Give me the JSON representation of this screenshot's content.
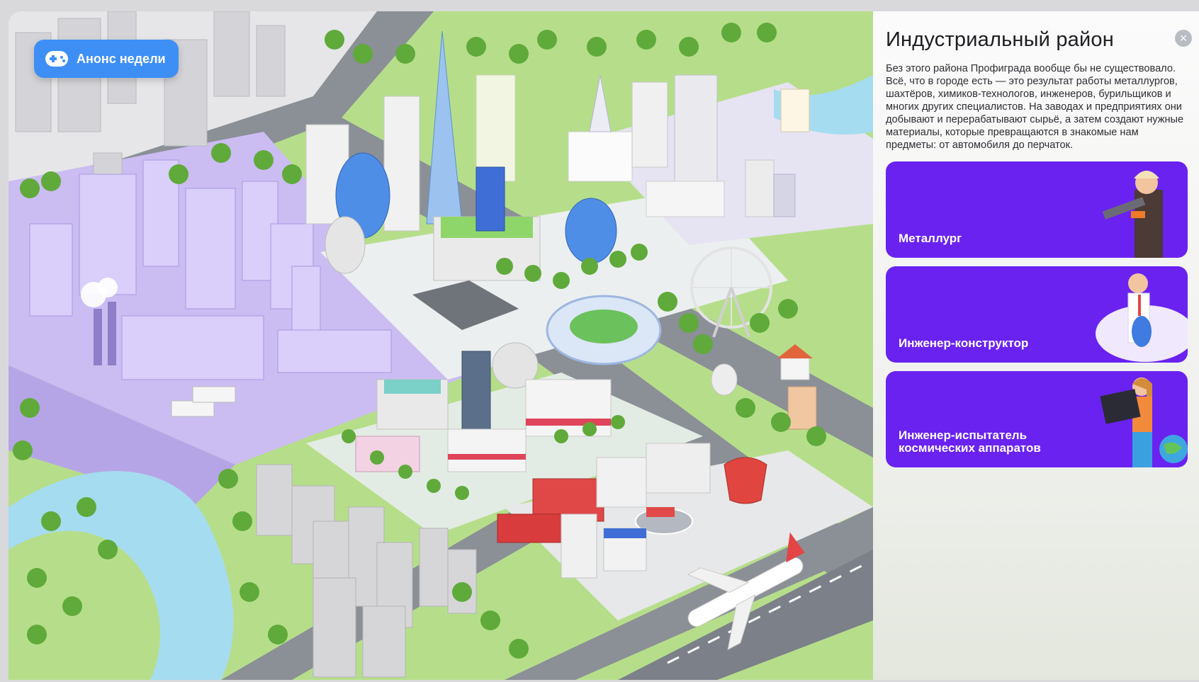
{
  "announce": {
    "label": "Анонс недели",
    "icon": "gamepad-icon"
  },
  "panel": {
    "title": "Индустриальный район",
    "description": "Без этого района Профиграда вообще бы не существовало. Всё, что в городе есть — это результат работы металлургов, шахтёров, химиков-технологов, инженеров, бурильщиков и многих других специалистов. На заводах и предприятиях они добывают и перерабатывают сырьё, а затем создают нужные материалы, которые превращаются в знакомые нам предметы: от автомобиля до перчаток.",
    "close_icon": "close-icon",
    "cards": [
      {
        "label": "Металлург"
      },
      {
        "label": "Инженер-конструктор"
      },
      {
        "label": "Инженер-испытатель космических аппаратов"
      }
    ]
  },
  "colors": {
    "accent_blue": "#3d8ff5",
    "card_purple": "#6a22f0",
    "industrial_lavender": "#c9b8f2",
    "grass": "#a8d67a",
    "river": "#a5dcf0",
    "road": "#8b8f96"
  }
}
